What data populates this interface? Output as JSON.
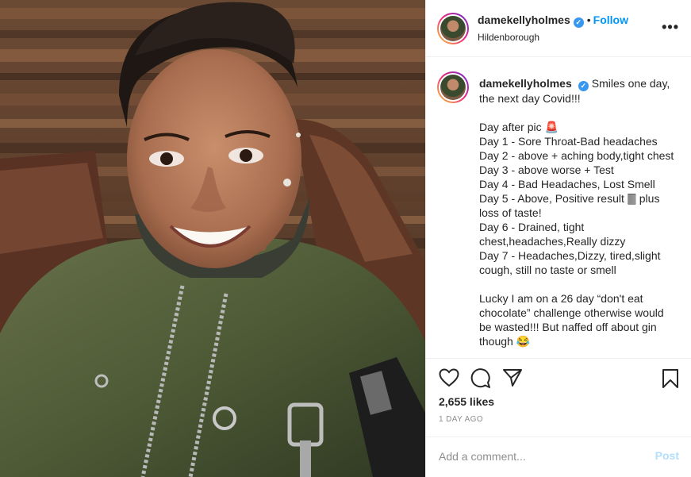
{
  "post": {
    "username": "damekellyholmes",
    "verified_glyph": "✓",
    "separator": "•",
    "follow_label": "Follow",
    "location": "Hildenborough",
    "more_icon": "more-horizontal-icon",
    "more_glyph": "•••"
  },
  "caption": {
    "username": "damekellyholmes",
    "text": "Smiles one day, the next day Covid!!!\n\nDay after pic 🚨\nDay 1 - Sore Throat-Bad headaches\nDay 2 - above + aching body,tight chest\nDay 3 - above worse + Test\nDay 4 - Bad Headaches, Lost Smell\nDay 5 - Above, Positive result 🀫 plus loss of taste!\nDay 6 - Drained, tight chest,headaches,Really dizzy\nDay 7 - Headaches,Dizzy, tired,slight cough, still no taste or smell\n\nLucky I am on a 26 day “don't eat chocolate” challenge otherwise would be wasted!!! But naffed off about gin though 😂"
  },
  "actions": {
    "like_icon": "heart-icon",
    "comment_icon": "comment-icon",
    "share_icon": "share-icon",
    "save_icon": "bookmark-icon",
    "likes": "2,655 likes",
    "time": "1 DAY AGO"
  },
  "comment": {
    "placeholder": "Add a comment...",
    "post_label": "Post"
  },
  "colors": {
    "accent": "#0095f6",
    "post_disabled": "#b2dffc",
    "muted": "#8e8e8e",
    "text": "#262626"
  }
}
